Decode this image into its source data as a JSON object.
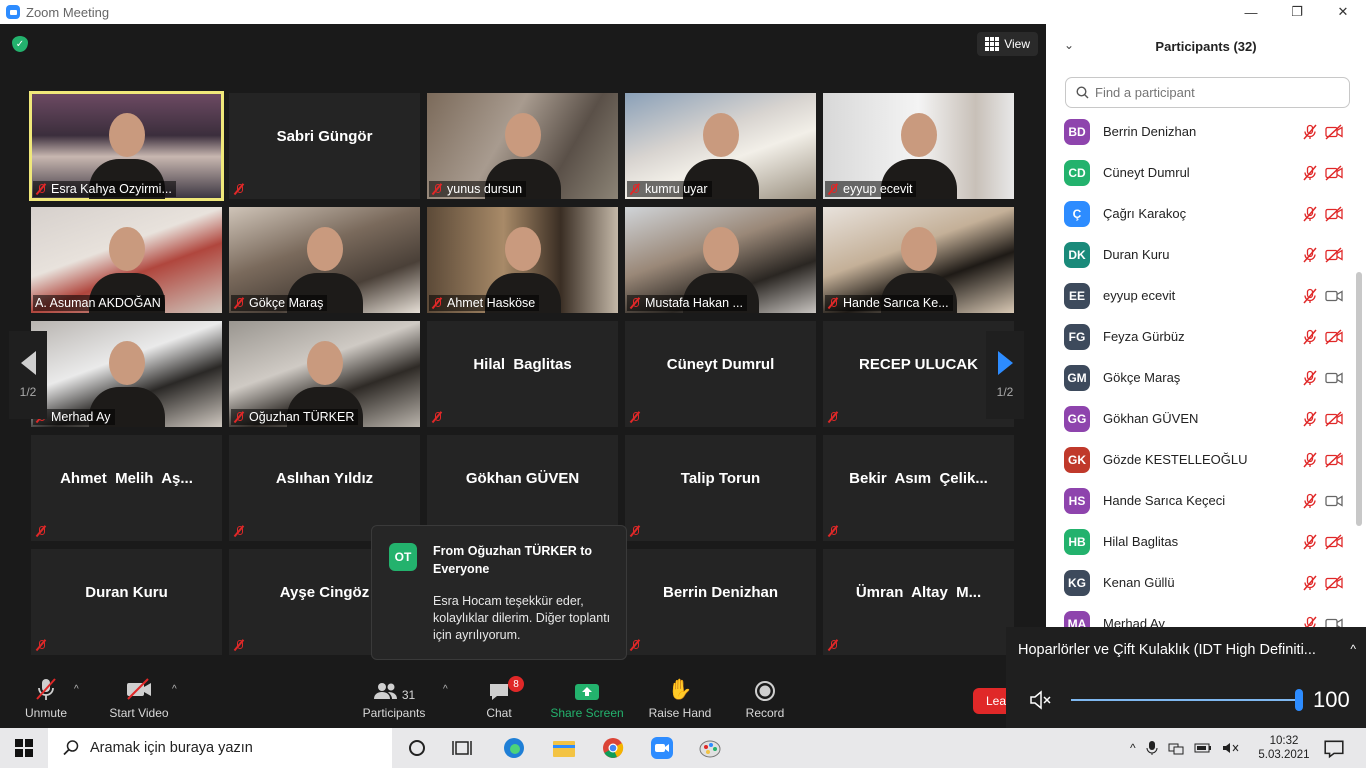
{
  "window": {
    "title": "Zoom Meeting"
  },
  "view_button": {
    "label": "View"
  },
  "tiles": [
    {
      "name": "Esra Kahya Ozyirmi...",
      "video": true,
      "active": true
    },
    {
      "name": "Sabri Güngör",
      "video": false
    },
    {
      "name": "yunus dursun",
      "video": true
    },
    {
      "name": "kumru uyar",
      "video": true
    },
    {
      "name": "eyyup ecevit",
      "video": true
    },
    {
      "name": "A. Asuman AKDOĞAN",
      "video": true
    },
    {
      "name": "Gökçe Maraş",
      "video": true
    },
    {
      "name": "Ahmet Hasköse",
      "video": true
    },
    {
      "name": "Mustafa Hakan ...",
      "video": true
    },
    {
      "name": "Hande Sarıca Ke...",
      "video": true
    },
    {
      "name": "Merhad Ay",
      "video": true
    },
    {
      "name": "Oğuzhan TÜRKER",
      "video": true
    },
    {
      "name": "Hilal  Baglitas",
      "video": false
    },
    {
      "name": "Cüneyt Dumrul",
      "video": false
    },
    {
      "name": "RECEP ULUCAK",
      "video": false
    },
    {
      "name": "Ahmet  Melih  Aş...",
      "video": false
    },
    {
      "name": "Aslıhan Yıldız",
      "video": false
    },
    {
      "name": "Gökhan GÜVEN",
      "video": false
    },
    {
      "name": "Talip Torun",
      "video": false
    },
    {
      "name": "Bekir  Asım  Çelik...",
      "video": false
    },
    {
      "name": "Duran Kuru",
      "video": false
    },
    {
      "name": "Ayşe Cingöz",
      "video": false
    },
    {
      "name": "",
      "video": false
    },
    {
      "name": "Berrin Denizhan",
      "video": false
    },
    {
      "name": "Ümran  Altay  M...",
      "video": false
    }
  ],
  "pager": {
    "left": "1/2",
    "right": "1/2"
  },
  "chat_popup": {
    "avatar": "OT",
    "from": "From Oğuzhan TÜRKER to Everyone",
    "message": "Esra Hocam teşekkür eder, kolaylıklar dilerim. Diğer toplantı için ayrılıyorum."
  },
  "toolbar": {
    "unmute": "Unmute",
    "start_video": "Start Video",
    "participants": "Participants",
    "participants_count": "31",
    "chat": "Chat",
    "chat_badge": "8",
    "share_screen": "Share Screen",
    "raise_hand": "Raise Hand",
    "record": "Record",
    "leave": "Lea"
  },
  "panel": {
    "title": "Participants (32)",
    "search_placeholder": "Find a participant",
    "participants": [
      {
        "initials": "BD",
        "name": "Berrin Denizhan",
        "color": "#8e44ad",
        "cam_on": false
      },
      {
        "initials": "CD",
        "name": "Cüneyt Dumrul",
        "color": "#23b26d",
        "cam_on": false
      },
      {
        "initials": "Ç",
        "name": "Çağrı Karakoç",
        "color": "#2d8cff",
        "cam_on": false
      },
      {
        "initials": "DK",
        "name": "Duran Kuru",
        "color": "#1a8a7a",
        "cam_on": false
      },
      {
        "initials": "EE",
        "name": "eyyup ecevit",
        "color": "#3d4a5c",
        "cam_on": true
      },
      {
        "initials": "FG",
        "name": "Feyza Gürbüz",
        "color": "#3d4a5c",
        "cam_on": false
      },
      {
        "initials": "GM",
        "name": "Gökçe Maraş",
        "color": "#3d4a5c",
        "cam_on": true
      },
      {
        "initials": "GG",
        "name": "Gökhan GÜVEN",
        "color": "#8e44ad",
        "cam_on": false
      },
      {
        "initials": "GK",
        "name": "Gözde KESTELLEOĞLU",
        "color": "#c0392b",
        "cam_on": false
      },
      {
        "initials": "HS",
        "name": "Hande Sarıca Keçeci",
        "color": "#8e44ad",
        "cam_on": true
      },
      {
        "initials": "HB",
        "name": "Hilal  Baglitas",
        "color": "#23b26d",
        "cam_on": false
      },
      {
        "initials": "KG",
        "name": "Kenan Güllü",
        "color": "#3d4a5c",
        "cam_on": false
      },
      {
        "initials": "MA",
        "name": "Merhad Ay",
        "color": "#8e44ad",
        "cam_on": true
      }
    ]
  },
  "volume": {
    "device": "Hoparlörler ve Çift Kulaklık (IDT High Definiti...",
    "level": 100,
    "level_label": "100"
  },
  "taskbar": {
    "search_text": "Aramak için buraya yazın",
    "time": "10:32",
    "date": "5.03.2021"
  },
  "colors": {
    "accent": "#2d8cff",
    "mute_red": "#e02828",
    "share_green": "#23b26d",
    "active_speaker": "#f0e87a"
  }
}
